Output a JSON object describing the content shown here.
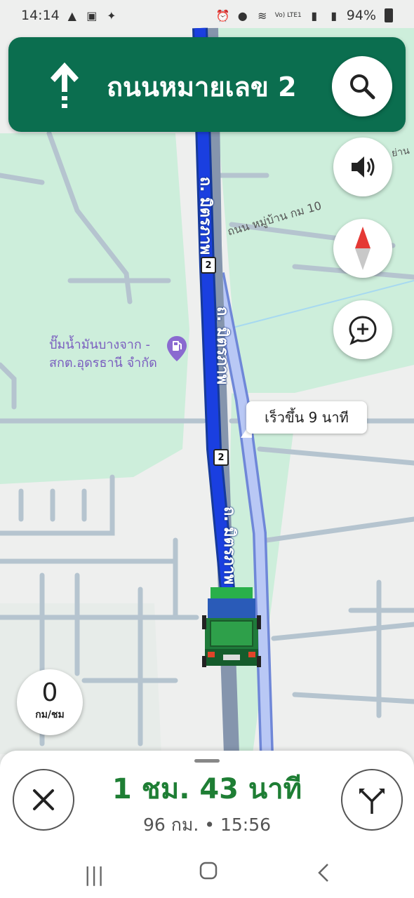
{
  "status_bar": {
    "time": "14:14",
    "battery": "94%",
    "network": "Vo) LTE1"
  },
  "navigation": {
    "street": "ถนนหมายเลข 2",
    "direction": "straight"
  },
  "map": {
    "labels": {
      "village_road": "ถนน หมู่บ้าน กม 10",
      "poi_line1": "ปั๊มน้ำมันบางจาก -",
      "poi_line2": "สกต.อุดรธานี จำกัด",
      "road_name_1": "ถ. มิตรภาพ",
      "road_name_2": "ถ. มิตรภาพ",
      "road_name_3": "ถ. มิตรภาพ",
      "corner_text": "ย่าน",
      "shield_number": "2"
    },
    "callout": "เร็วขึ้น 9 นาที"
  },
  "speedometer": {
    "value": "0",
    "unit": "กม/ชม"
  },
  "trip": {
    "duration": "1 ชม. 43 นาที",
    "distance": "96 กม.",
    "separator": "•",
    "arrival": "15:56"
  },
  "colors": {
    "banner": "#0b6e4f",
    "route": "#1a3fe0",
    "alt_route": "#9db3f0",
    "eta": "#1e7e34",
    "green_area": "#cdeedb"
  },
  "icons": [
    "up-arrow-icon",
    "search-icon",
    "volume-icon",
    "compass-icon",
    "add-report-icon",
    "fuel-icon",
    "close-icon",
    "route-options-icon"
  ]
}
